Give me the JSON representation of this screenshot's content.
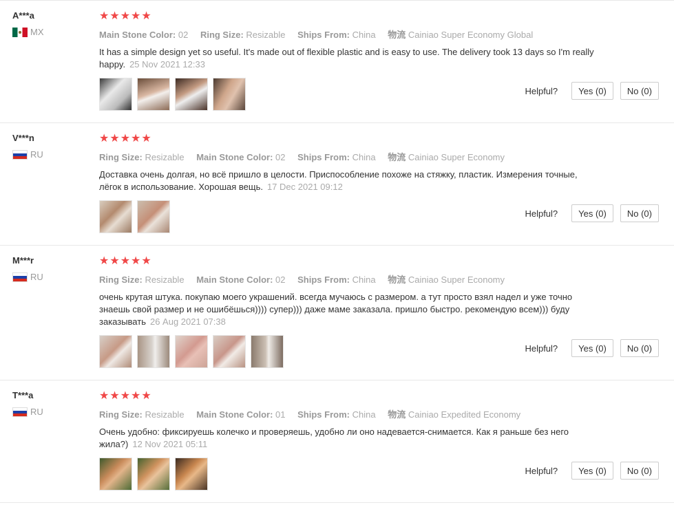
{
  "helpful_label": "Helpful?",
  "reviews": [
    {
      "user": "A***a",
      "country_code": "MX",
      "flag": "mexico-flag-icon",
      "stars": "★★★★★",
      "attrs": [
        {
          "k": "Main Stone Color:",
          "v": "02"
        },
        {
          "k": "Ring Size:",
          "v": "Resizable"
        },
        {
          "k": "Ships From:",
          "v": "China"
        },
        {
          "k": "物流",
          "v": "Cainiao Super Economy Global"
        }
      ],
      "text": "It has a simple design yet so useful. It's made out of flexible plastic and is easy to use. The delivery took 13 days so I'm really happy.",
      "date": "25 Nov 2021 12:33",
      "yes": "Yes (0)",
      "no": "No (0)"
    },
    {
      "user": "V***n",
      "country_code": "RU",
      "flag": "russia-flag-icon",
      "stars": "★★★★★",
      "attrs": [
        {
          "k": "Ring Size:",
          "v": "Resizable"
        },
        {
          "k": "Main Stone Color:",
          "v": "02"
        },
        {
          "k": "Ships From:",
          "v": "China"
        },
        {
          "k": "物流",
          "v": "Cainiao Super Economy"
        }
      ],
      "text": "Доставка очень долгая, но всё пришло в целости. Приспособление похоже на стяжку, пластик. Измерения точные, лёгок в использование. Хорошая вещь.",
      "date": "17 Dec 2021 09:12",
      "yes": "Yes (0)",
      "no": "No (0)"
    },
    {
      "user": "M***r",
      "country_code": "RU",
      "flag": "russia-flag-icon",
      "stars": "★★★★★",
      "attrs": [
        {
          "k": "Ring Size:",
          "v": "Resizable"
        },
        {
          "k": "Main Stone Color:",
          "v": "02"
        },
        {
          "k": "Ships From:",
          "v": "China"
        },
        {
          "k": "物流",
          "v": "Cainiao Super Economy"
        }
      ],
      "text": "очень крутая штука. покупаю моего украшений. всегда мучаюсь с размером. а тут просто взял надел и уже точно знаешь свой размер и не ошибёшься)))) супер))) даже маме заказала. пришло быстро. рекомендую всем))) буду заказывать",
      "date": "26 Aug 2021 07:38",
      "yes": "Yes (0)",
      "no": "No (0)"
    },
    {
      "user": "T***a",
      "country_code": "RU",
      "flag": "russia-flag-icon",
      "stars": "★★★★★",
      "attrs": [
        {
          "k": "Ring Size:",
          "v": "Resizable"
        },
        {
          "k": "Main Stone Color:",
          "v": "01"
        },
        {
          "k": "Ships From:",
          "v": "China"
        },
        {
          "k": "物流",
          "v": "Cainiao Expedited Economy"
        }
      ],
      "text": "Очень удобно: фиксируешь колечко и проверяешь, удобно ли оно надевается-снимается. Как я раньше без него жила?)",
      "date": "12 Nov 2021 05:11",
      "yes": "Yes (0)",
      "no": "No (0)"
    }
  ]
}
